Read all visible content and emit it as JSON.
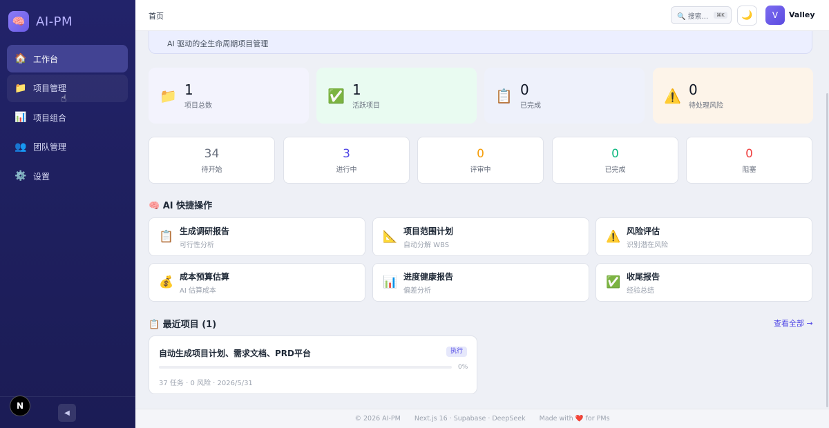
{
  "brand": {
    "logo_icon": "🧠",
    "name": "AI-PM"
  },
  "sidebar": {
    "items": [
      {
        "icon": "🏠",
        "label": "工作台"
      },
      {
        "icon": "📁",
        "label": "项目管理"
      },
      {
        "icon": "📊",
        "label": "项目组合"
      },
      {
        "icon": "👥",
        "label": "团队管理"
      },
      {
        "icon": "⚙️",
        "label": "设置"
      }
    ],
    "next_badge": "N",
    "collapse_icon": "◀"
  },
  "header": {
    "breadcrumb": "首页",
    "search_placeholder": "🔍 搜索...",
    "search_shortcut": "⌘K",
    "theme_icon": "🌙",
    "avatar_initial": "V",
    "user_name": "Valley"
  },
  "hero": {
    "subtitle": "AI 驱动的全生命周期项目管理"
  },
  "stats": [
    {
      "icon": "📁",
      "value": "1",
      "label": "项目总数",
      "bg": "#f3f3fd"
    },
    {
      "icon": "✅",
      "value": "1",
      "label": "活跃项目",
      "bg": "#e9fbf1"
    },
    {
      "icon": "📋",
      "value": "0",
      "label": "已完成",
      "bg": "#eef1fb"
    },
    {
      "icon": "⚠️",
      "value": "0",
      "label": "待处理风险",
      "bg": "#fdf4e9"
    }
  ],
  "status_counts": [
    {
      "value": "34",
      "label": "待开始",
      "color": "#6b7280"
    },
    {
      "value": "3",
      "label": "进行中",
      "color": "#4f46e5"
    },
    {
      "value": "0",
      "label": "评审中",
      "color": "#f59e0b"
    },
    {
      "value": "0",
      "label": "已完成",
      "color": "#10b981"
    },
    {
      "value": "0",
      "label": "阻塞",
      "color": "#ef4444"
    }
  ],
  "quick_actions": {
    "title": "🧠 AI 快捷操作",
    "items": [
      {
        "icon": "📋",
        "title": "生成调研报告",
        "subtitle": "可行性分析"
      },
      {
        "icon": "📐",
        "title": "项目范围计划",
        "subtitle": "自动分解 WBS"
      },
      {
        "icon": "⚠️",
        "title": "风险评估",
        "subtitle": "识别潜在风险"
      },
      {
        "icon": "💰",
        "title": "成本预算估算",
        "subtitle": "AI 估算成本"
      },
      {
        "icon": "📊",
        "title": "进度健康报告",
        "subtitle": "偏差分析"
      },
      {
        "icon": "✅",
        "title": "收尾报告",
        "subtitle": "经验总结"
      }
    ]
  },
  "recent": {
    "title": "📋 最近项目 (1)",
    "view_all": "查看全部 →",
    "projects": [
      {
        "title": "自动生成项目计划、需求文档、PRD平台",
        "badge": "执行",
        "progress": 0,
        "progress_label": "0%",
        "meta": "37 任务 · 0 风险 · 2026/5/31"
      }
    ]
  },
  "footer": {
    "copyright": "© 2026 AI-PM",
    "stack": "Next.js 16 · Supabase · DeepSeek",
    "made_with": "Made with ❤️ for PMs"
  }
}
